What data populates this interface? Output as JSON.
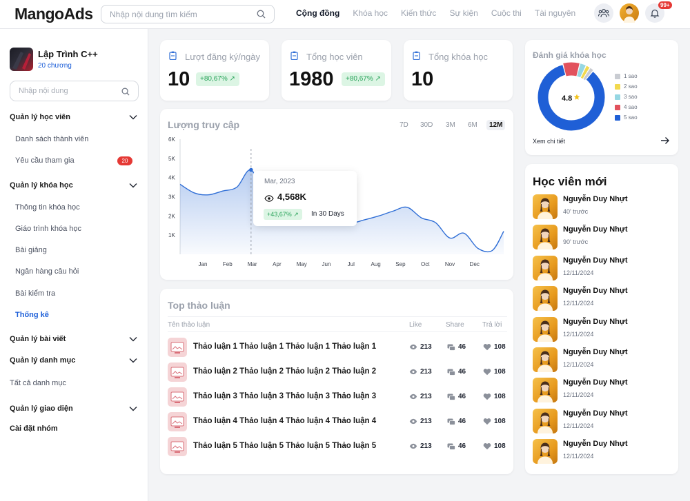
{
  "app": {
    "logo": "MangoAds"
  },
  "header": {
    "search_placeholder": "Nhập nội dung tìm kiếm",
    "tabs": [
      {
        "label": "Cộng đồng",
        "active": true
      },
      {
        "label": "Khóa học",
        "active": false
      },
      {
        "label": "Kiến thức",
        "active": false
      },
      {
        "label": "Sự kiện",
        "active": false
      },
      {
        "label": "Cuộc thi",
        "active": false
      },
      {
        "label": "Tài nguyên",
        "active": false
      }
    ],
    "notification_badge": "99+",
    "icons": [
      "search-icon",
      "community-icon",
      "avatar",
      "bell-icon"
    ]
  },
  "sidebar": {
    "course_title": "Lập Trình C++",
    "course_subtitle": "20 chương",
    "search_placeholder": "Nhập nội dung",
    "groups": [
      {
        "label": "Quản lý học viên",
        "items": [
          {
            "label": "Danh sách thành viên"
          },
          {
            "label": "Yêu cầu tham gia",
            "badge": "20"
          }
        ]
      },
      {
        "label": "Quản lý khóa học",
        "items": [
          {
            "label": "Thông tin khóa học"
          },
          {
            "label": "Giáo trình khóa học"
          },
          {
            "label": "Bài giảng"
          },
          {
            "label": "Ngân hàng câu hỏi"
          },
          {
            "label": "Bài kiểm tra"
          },
          {
            "label": "Thống kê",
            "active": true
          }
        ]
      },
      {
        "label": "Quản lý bài viết"
      },
      {
        "label": "Quản lý danh mục",
        "items": [
          {
            "label": "Tất cả danh mục"
          }
        ]
      },
      {
        "label": "Quản lý giao diện"
      },
      {
        "label": "Cài đặt nhóm"
      }
    ]
  },
  "stats": [
    {
      "label": "Lượt đăng ký/ngày",
      "value": "10",
      "change": "+80,67%"
    },
    {
      "label": "Tổng học viên",
      "value": "1980",
      "change": "+80,67%"
    },
    {
      "label": "Tổng khóa học",
      "value": "10"
    }
  ],
  "traffic": {
    "title": "Lượng truy cập",
    "ranges": [
      "7D",
      "30D",
      "3M",
      "6M",
      "12M"
    ],
    "active_range": "12M",
    "tooltip": {
      "date": "Mar, 2023",
      "value": "4,568K",
      "change": "+43,67%",
      "note": "In 30 Days"
    }
  },
  "chart_data": {
    "type": "area",
    "title": "Lượng truy cập",
    "xlabel": "",
    "ylabel": "",
    "y_ticks": [
      "1K",
      "2K",
      "3K",
      "4K",
      "5K",
      "6K"
    ],
    "ylim": [
      0,
      6000
    ],
    "x_ticks": [
      "Jan",
      "Feb",
      "Mar",
      "Apr",
      "May",
      "Jun",
      "Jul",
      "Aug",
      "Sep",
      "Oct",
      "Nov",
      "Dec"
    ],
    "grid": false,
    "color": "#2f6ed6",
    "highlight_index": 3,
    "x": [
      0,
      0.5,
      1,
      1.5,
      2,
      2.5,
      3,
      3.5,
      4,
      4.5,
      5,
      5.5,
      6,
      6.5,
      7,
      7.5,
      8,
      8.5,
      9,
      9.5,
      10,
      10.5,
      11,
      11.4
    ],
    "y": [
      3650,
      3200,
      3100,
      3300,
      3500,
      4400,
      2850,
      2150,
      1650,
      1700,
      1650,
      2000,
      1650,
      1800,
      2000,
      2250,
      2450,
      1900,
      1650,
      850,
      1100,
      300,
      200,
      1200
    ]
  },
  "discussions": {
    "title": "Top thảo luận",
    "columns": [
      "Tên thảo luận",
      "Like",
      "Share",
      "Trả lời"
    ],
    "rows": [
      {
        "title": "Thảo luận 1 Thảo luận 1 Thảo luận 1 Thảo luận 1",
        "like": "213",
        "share": "46",
        "reply": "108"
      },
      {
        "title": "Thảo luận 2 Thảo luận 2 Thảo luận 2 Thảo luận 2",
        "like": "213",
        "share": "46",
        "reply": "108"
      },
      {
        "title": "Thảo luận 3 Thảo luận 3 Thảo luận 3 Thảo luận 3",
        "like": "213",
        "share": "46",
        "reply": "108"
      },
      {
        "title": "Thảo luận 4 Thảo luận 4 Thảo luận 4 Thảo luận 4",
        "like": "213",
        "share": "46",
        "reply": "108"
      },
      {
        "title": "Thảo luận 5 Thảo luận 5 Thảo luận 5 Thảo luận 5",
        "like": "213",
        "share": "46",
        "reply": "108"
      }
    ]
  },
  "rating": {
    "title": "Đánh giá khóa học",
    "score": "4.8",
    "legend": [
      {
        "label": "1 sao",
        "color": "#c9ccd2",
        "share": 0.02
      },
      {
        "label": "2 sao",
        "color": "#f2d94e",
        "share": 0.02
      },
      {
        "label": "3 sao",
        "color": "#96d7e3",
        "share": 0.03
      },
      {
        "label": "4 sao",
        "color": "#e2525d",
        "share": 0.08
      },
      {
        "label": "5 sao",
        "color": "#1f5fd6",
        "share": 0.85
      }
    ],
    "see_detail": "Xem chi tiết"
  },
  "new_students": {
    "title": "Học viên mới",
    "items": [
      {
        "name": "Nguyễn Duy Nhựt",
        "time": "40' trước"
      },
      {
        "name": "Nguyễn Duy Nhựt",
        "time": "90' trước"
      },
      {
        "name": "Nguyễn Duy Nhựt",
        "time": "12/11/2024"
      },
      {
        "name": "Nguyễn Duy Nhựt",
        "time": "12/11/2024"
      },
      {
        "name": "Nguyễn Duy Nhựt",
        "time": "12/11/2024"
      },
      {
        "name": "Nguyễn Duy Nhựt",
        "time": "12/11/2024"
      },
      {
        "name": "Nguyễn Duy Nhựt",
        "time": "12/11/2024"
      },
      {
        "name": "Nguyễn Duy Nhựt",
        "time": "12/11/2024"
      },
      {
        "name": "Nguyễn Duy Nhựt",
        "time": "12/11/2024"
      }
    ]
  }
}
